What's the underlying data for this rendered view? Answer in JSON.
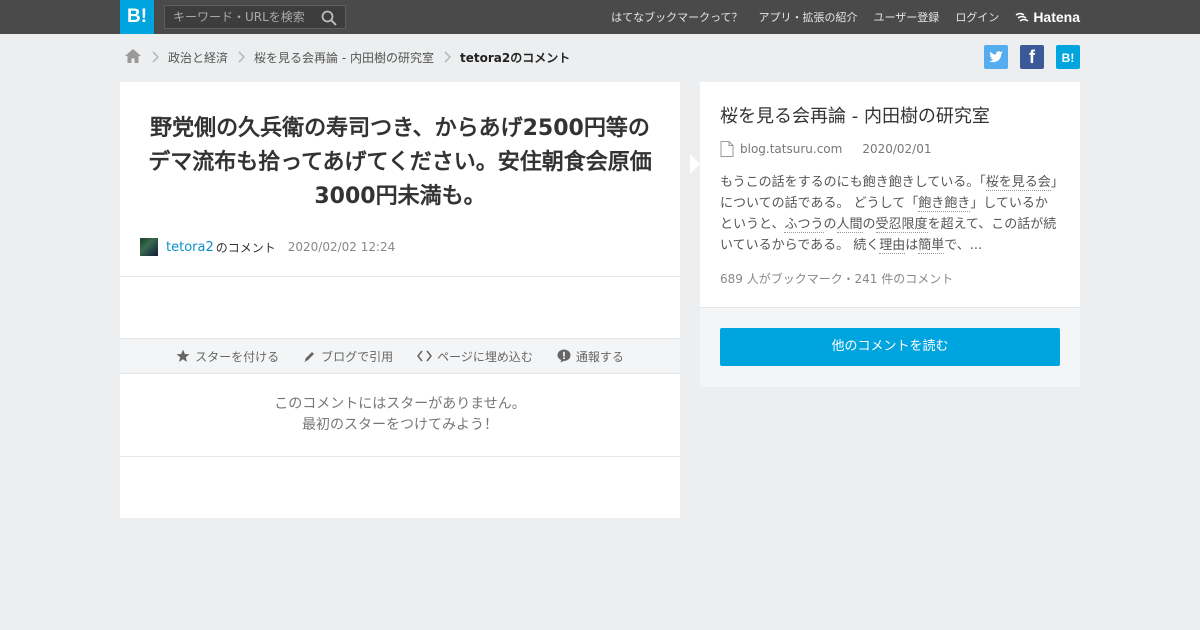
{
  "header": {
    "logo_text": "B!",
    "search_placeholder": "キーワード・URLを検索",
    "nav": [
      "はてなブックマークって？",
      "アプリ・拡張の紹介",
      "ユーザー登録",
      "ログイン"
    ],
    "brand": "Hatena"
  },
  "breadcrumb": {
    "items": [
      "政治と経済",
      "桜を見る会再論 - 内田樹の研究室"
    ],
    "current": "tetora2のコメント"
  },
  "share": {
    "twitter_label": "",
    "facebook_label": "f",
    "hatena_label": "B!",
    "colors": {
      "twitter": "#55acee",
      "facebook": "#3b5998",
      "hatena": "#00a4de"
    }
  },
  "comment": {
    "text": "野党側の久兵衛の寿司つき、からあげ2500円等のデマ流布も拾ってあげてください。安住朝食会原価3000円未満も。",
    "user": "tetora2",
    "user_suffix": "のコメント",
    "date": "2020/02/02 12:24"
  },
  "actions": {
    "star": "スターを付ける",
    "quote": "ブログで引用",
    "embed": "ページに埋め込む",
    "report": "通報する"
  },
  "stars": {
    "line1": "このコメントにはスターがありません。",
    "line2": "最初のスターをつけてみよう！"
  },
  "entry": {
    "title": "桜を見る会再論 - 内田樹の研究室",
    "domain": "blog.tatsuru.com",
    "date": "2020/02/01",
    "desc_parts": [
      "もうこの話をするのにも飽き飽きしている。「",
      "桜を見る会",
      "」についての話である。 どうして「",
      "飽き飽き",
      "」しているかというと、",
      "ふつう",
      "の",
      "人間",
      "の",
      "受忍限度",
      "を超えて、この話が続いているからである。 続く",
      "理由",
      "は",
      "簡単",
      "で、..."
    ],
    "counts": "689 人がブックマーク・241 件のコメント",
    "read_more": "他のコメントを読む"
  }
}
